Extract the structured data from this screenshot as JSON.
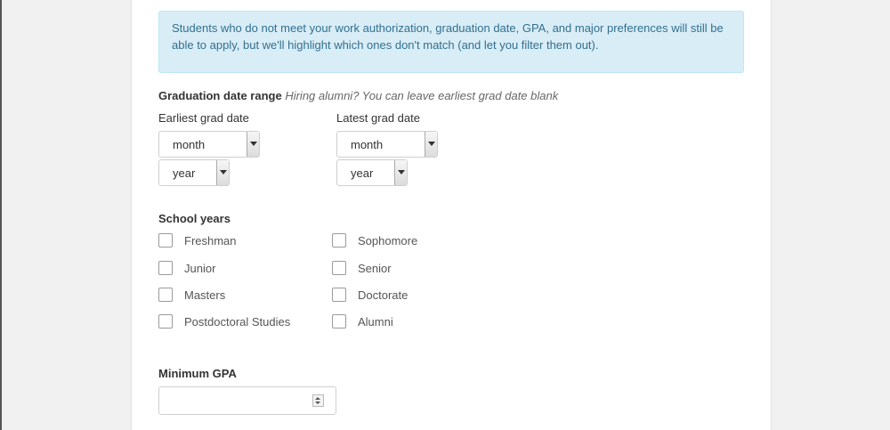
{
  "info_message": "Students who do not meet your work authorization, graduation date, GPA, and major preferences will still be able to apply, but we'll highlight which ones don't match (and let you filter them out).",
  "graduation": {
    "label": "Graduation date range",
    "hint": "Hiring alumni? You can leave earliest grad date blank",
    "earliest": {
      "label": "Earliest grad date",
      "month": "month",
      "year": "year"
    },
    "latest": {
      "label": "Latest grad date",
      "month": "month",
      "year": "year"
    }
  },
  "school_years": {
    "label": "School years",
    "options": [
      {
        "label": "Freshman",
        "checked": false
      },
      {
        "label": "Sophomore",
        "checked": false
      },
      {
        "label": "Junior",
        "checked": false
      },
      {
        "label": "Senior",
        "checked": false
      },
      {
        "label": "Masters",
        "checked": false
      },
      {
        "label": "Doctorate",
        "checked": false
      },
      {
        "label": "Postdoctoral Studies",
        "checked": false
      },
      {
        "label": "Alumni",
        "checked": false
      }
    ]
  },
  "gpa": {
    "label": "Minimum GPA",
    "value": ""
  },
  "colors": {
    "info_bg": "#d9edf7",
    "info_border": "#bce8f1",
    "info_text": "#31708f"
  }
}
